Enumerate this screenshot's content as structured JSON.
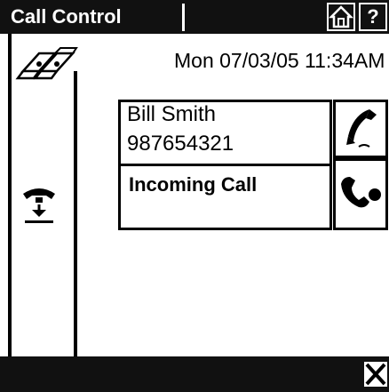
{
  "title_bar": {
    "title": "Call Control",
    "home_icon": "home-icon",
    "help_label": "?"
  },
  "left_panel": {
    "address_book_icon": "address-book-icon",
    "status_icon": "phone-status-icon"
  },
  "datetime": "Mon 07/03/05 11:34AM",
  "call": {
    "caller_name": "Bill Smith",
    "caller_number": "987654321",
    "status": "Incoming Call",
    "answer_icon": "answer-call-icon",
    "decline_icon": "decline-call-icon"
  },
  "bottom_bar": {
    "close_icon": "close-icon"
  }
}
